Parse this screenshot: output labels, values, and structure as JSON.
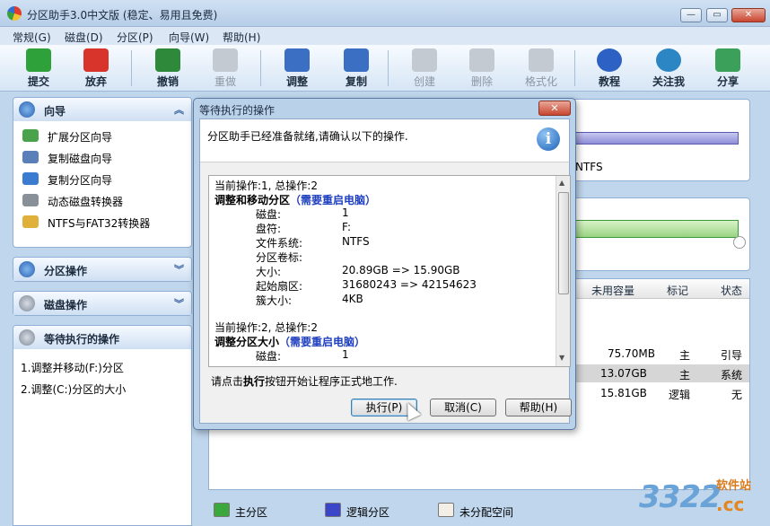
{
  "window": {
    "title": "分区助手3.0中文版 (稳定、易用且免费)",
    "minimize": "—",
    "restore": "▭",
    "close": "✕"
  },
  "menu": [
    "常规(G)",
    "磁盘(D)",
    "分区(P)",
    "向导(W)",
    "帮助(H)"
  ],
  "toolbar": [
    {
      "label": "提交",
      "icon": "checkmark-icon",
      "color": "#2fa13a",
      "enabled": true
    },
    {
      "label": "放弃",
      "icon": "cross-icon",
      "color": "#d8342c",
      "enabled": true
    },
    {
      "label": "撤销",
      "icon": "undo-icon",
      "color": "#2e8a3a",
      "enabled": true
    },
    {
      "label": "重做",
      "icon": "redo-icon",
      "color": "#9aa3ad",
      "enabled": false
    },
    {
      "label": "调整",
      "icon": "resize-partition-icon",
      "color": "#3a6fc4",
      "enabled": true
    },
    {
      "label": "复制",
      "icon": "copy-partition-icon",
      "color": "#3a6fc4",
      "enabled": true
    },
    {
      "label": "创建",
      "icon": "create-partition-icon",
      "color": "#9aa3ad",
      "enabled": false
    },
    {
      "label": "删除",
      "icon": "delete-partition-icon",
      "color": "#9aa3ad",
      "enabled": false
    },
    {
      "label": "格式化",
      "icon": "format-icon",
      "color": "#9aa3ad",
      "enabled": false
    },
    {
      "label": "教程",
      "icon": "help-icon",
      "color": "#2d62c4",
      "enabled": true
    },
    {
      "label": "关注我",
      "icon": "globe-icon",
      "color": "#2d86c4",
      "enabled": true
    },
    {
      "label": "分享",
      "icon": "people-icon",
      "color": "#3aa05a",
      "enabled": true
    }
  ],
  "sidebar": {
    "wizard": {
      "title": "向导",
      "items": [
        "扩展分区向导",
        "复制磁盘向导",
        "复制分区向导",
        "动态磁盘转换器",
        "NTFS与FAT32转换器"
      ]
    },
    "partition_ops": {
      "title": "分区操作"
    },
    "disk_ops": {
      "title": "磁盘操作"
    },
    "pending": {
      "title": "等待执行的操作",
      "items": [
        "1.调整并移动(F:)分区",
        "2.调整(C:)分区的大小"
      ]
    }
  },
  "main": {
    "disk1_fs": "NTFS",
    "table_headers": [
      "未用容量",
      "标记",
      "状态"
    ],
    "rows": [
      {
        "free": "75.70MB",
        "flag": "主",
        "status": "引导"
      },
      {
        "free": "13.07GB",
        "flag": "主",
        "status": "系统"
      },
      {
        "free": "15.81GB",
        "flag": "逻辑",
        "status": "无"
      }
    ],
    "legend": [
      {
        "label": "主分区",
        "color": "#3aa83a"
      },
      {
        "label": "逻辑分区",
        "color": "#3b45c8"
      },
      {
        "label": "未分配空间",
        "color": "#f3efe6"
      }
    ]
  },
  "dialog": {
    "title": "等待执行的操作",
    "message": "分区助手已经准备就绪,请确认以下的操作.",
    "op1": {
      "header": "当前操作:1, 总操作:2",
      "name": "调整和移动分区",
      "warn": "（需要重启电脑）",
      "fields": [
        {
          "k": "磁盘:",
          "v": "1"
        },
        {
          "k": "盘符:",
          "v": "F:"
        },
        {
          "k": "文件系统:",
          "v": "NTFS"
        },
        {
          "k": "分区卷标:",
          "v": ""
        },
        {
          "k": "大小:",
          "v": "20.89GB => 15.90GB"
        },
        {
          "k": "起始扇区:",
          "v": "31680243 => 42154623"
        },
        {
          "k": "簇大小:",
          "v": "4KB"
        }
      ]
    },
    "op2": {
      "header": "当前操作:2, 总操作:2",
      "name": "调整分区大小",
      "warn": "（需要重启电脑）",
      "fields": [
        {
          "k": "磁盘:",
          "v": "1"
        }
      ]
    },
    "hint_pre": "请点击",
    "hint_bold": "执行",
    "hint_post": "按钮开始让程序正式地工作.",
    "buttons": {
      "execute": "执行(P)",
      "cancel": "取消(C)",
      "help": "帮助(H)"
    }
  },
  "watermark": {
    "num": "3322",
    "site": "软件站",
    "tld": ".cc"
  }
}
